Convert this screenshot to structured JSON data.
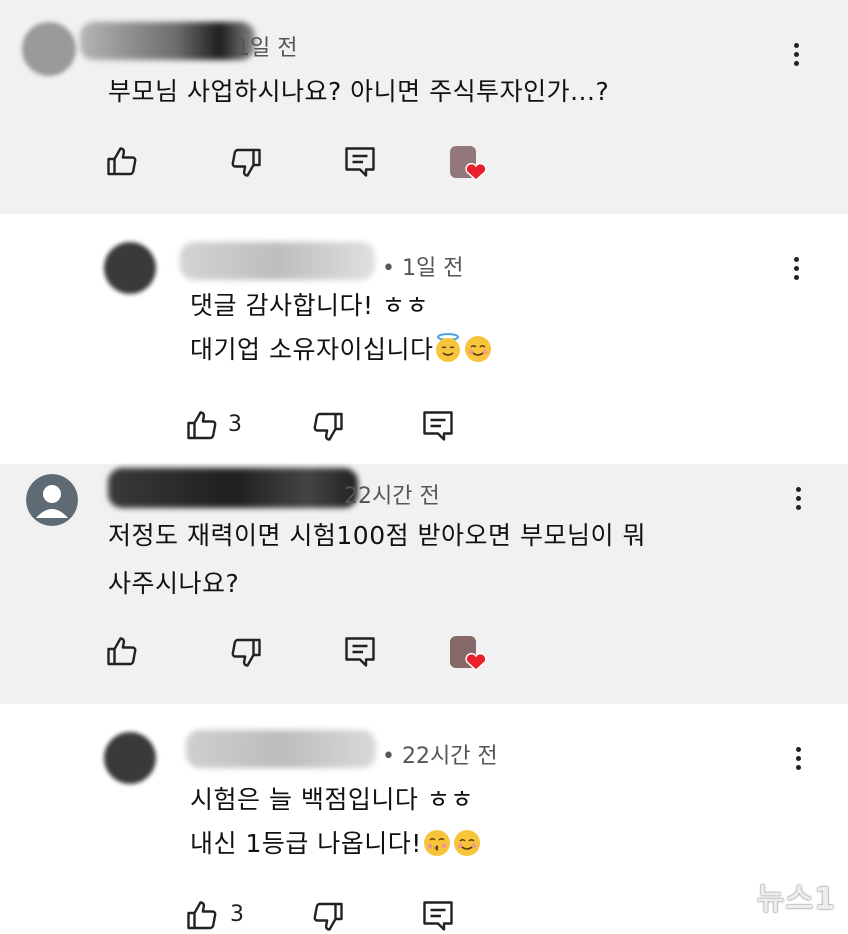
{
  "comments": [
    {
      "time": "1일 전",
      "lines": [
        "부모님 사업하시나요? 아니면 주식투자인가...?"
      ]
    },
    {
      "time": "• 1일 전",
      "lines": [
        "댓글 감사합니다! ㅎㅎ",
        "대기업 소유자이십니다"
      ],
      "likes": "3"
    },
    {
      "time": "22시간 전",
      "lines": [
        "저정도 재력이면 시험100점 받아오면 부모님이 뭐",
        "사주시나요?"
      ]
    },
    {
      "time": "• 22시간 전",
      "lines": [
        "시험은 늘 백점입니다 ㅎㅎ",
        "내신 1등급 나옵니다!"
      ],
      "likes": "3"
    }
  ],
  "icons": [
    "like-icon",
    "dislike-icon",
    "reply-icon",
    "creator-heart-icon",
    "more-icon",
    "halo-smile-emoji",
    "smile-emoji",
    "kiss-emoji"
  ],
  "colors": {
    "heart": "#e8202a",
    "gray_bg": "#f1f1f1"
  },
  "watermark": "뉴스1"
}
